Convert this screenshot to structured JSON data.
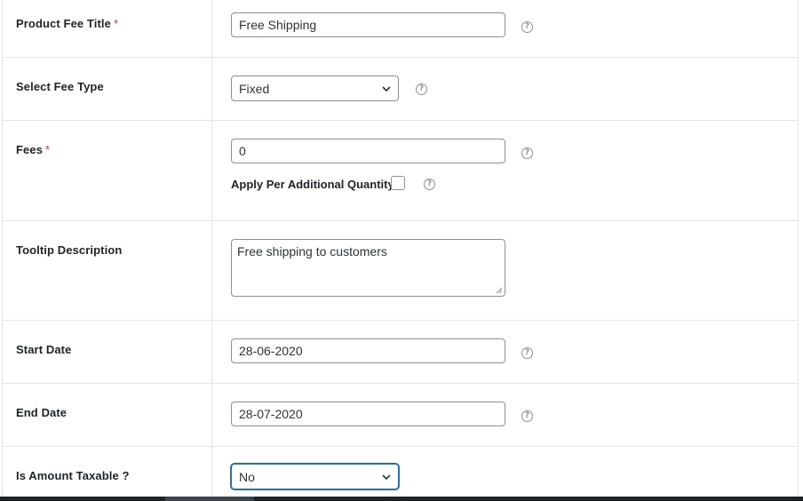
{
  "fields": {
    "title": {
      "label": "Product Fee Title",
      "required": "*",
      "value": "Free Shipping",
      "help_icon": "question-circle-icon"
    },
    "fee_type": {
      "label": "Select Fee Type",
      "selected": "Fixed",
      "help_icon": "question-circle-icon"
    },
    "fees": {
      "label": "Fees",
      "required": "*",
      "value": "0",
      "per_quantity_label": "Apply Per Additional Quantity",
      "per_quantity_checked": false
    },
    "tooltip": {
      "label": "Tooltip Description",
      "value": "Free shipping to customers"
    },
    "start_date": {
      "label": "Start Date",
      "value": "28-06-2020"
    },
    "end_date": {
      "label": "End Date",
      "value": "28-07-2020"
    },
    "taxable": {
      "label": "Is Amount Taxable ?",
      "selected": "No"
    }
  },
  "help_glyph": "?",
  "colors": {
    "border": "#8c8f94",
    "focus": "#2271b1",
    "required": "#d63638",
    "row_border": "#e2e4e7"
  }
}
